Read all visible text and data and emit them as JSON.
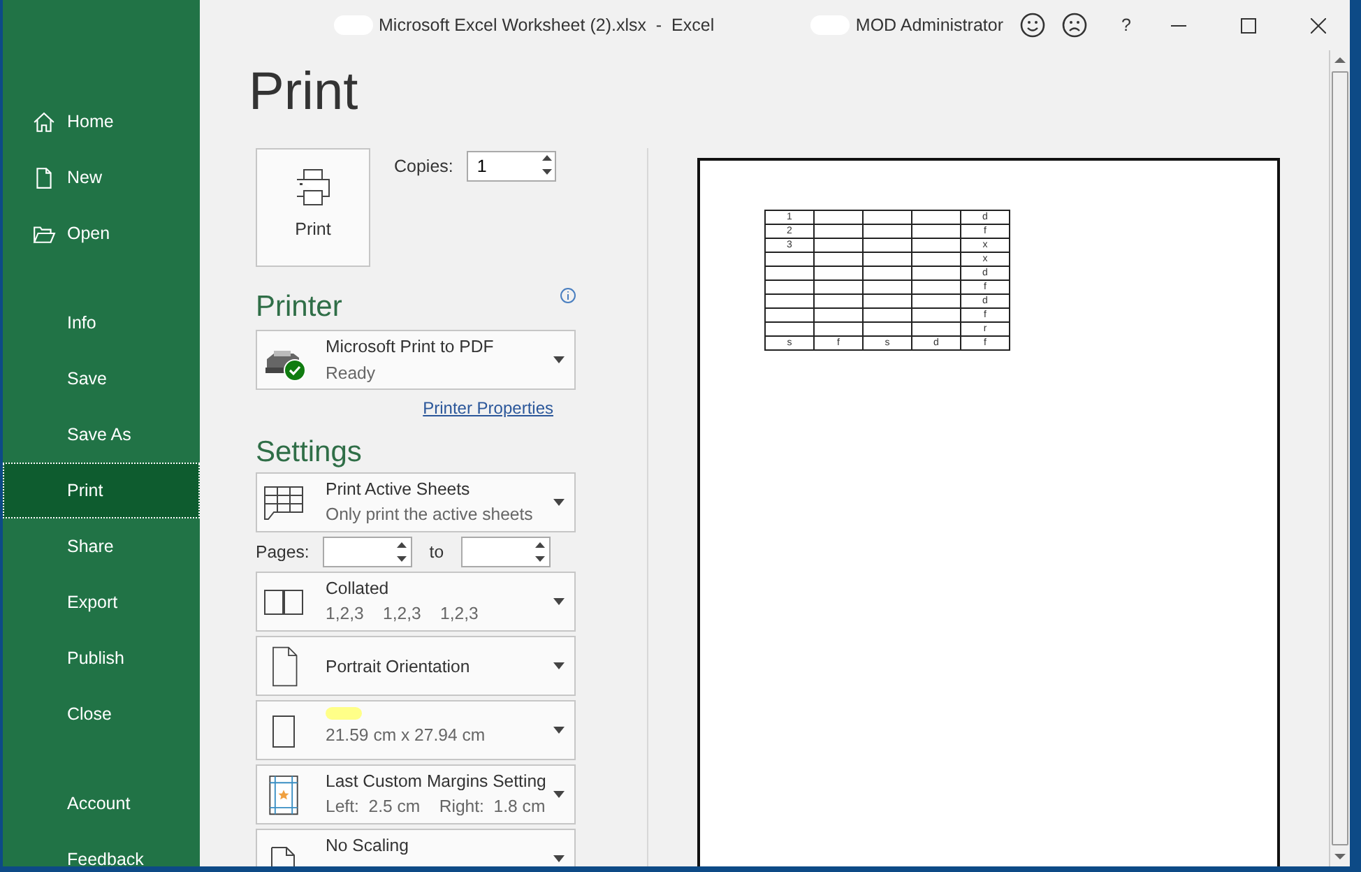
{
  "window": {
    "title": "Microsoft Excel Worksheet (2).xlsx  -  Excel",
    "title_redacted": true,
    "user": "MOD Administrator",
    "user_redacted": true,
    "help": "?"
  },
  "sidebar": {
    "groups": [
      [
        {
          "label": "Home",
          "selected": false
        },
        {
          "label": "New",
          "selected": false
        },
        {
          "label": "Open",
          "selected": false
        }
      ],
      [
        {
          "label": "Info",
          "selected": false
        },
        {
          "label": "Save",
          "selected": false
        },
        {
          "label": "Save As",
          "selected": false
        },
        {
          "label": "Print",
          "selected": true
        },
        {
          "label": "Share",
          "selected": false
        },
        {
          "label": "Export",
          "selected": false
        },
        {
          "label": "Publish",
          "selected": false
        },
        {
          "label": "Close",
          "selected": false
        }
      ],
      [
        {
          "label": "Account",
          "selected": false
        },
        {
          "label": "Feedback",
          "selected": false
        }
      ]
    ]
  },
  "print": {
    "heading": "Print",
    "button": "Print",
    "copies_label": "Copies:",
    "copies": "1"
  },
  "printer": {
    "heading": "Printer",
    "name": "Microsoft Print to PDF",
    "status": "Ready",
    "properties_link": "Printer Properties"
  },
  "settings": {
    "heading": "Settings",
    "items": [
      {
        "kind": "dropdown",
        "title": "Print Active Sheets",
        "subtitle": "Only print the active sheets"
      },
      {
        "kind": "pages",
        "label": "Pages:",
        "to": "to"
      },
      {
        "kind": "dropdown",
        "title": "Collated",
        "subtitle": "1,2,3    1,2,3    1,2,3"
      },
      {
        "kind": "dropdown",
        "title": "Portrait Orientation"
      },
      {
        "kind": "dropdown",
        "title_redacted": true,
        "subtitle": "21.59 cm x 27.94 cm"
      },
      {
        "kind": "dropdown",
        "title": "Last Custom Margins Setting",
        "subtitle": "Left:  2.5 cm    Right:  1.8 cm"
      },
      {
        "kind": "dropdown",
        "title": "No Scaling"
      }
    ]
  },
  "preview": {
    "rows": [
      [
        "1",
        null,
        null,
        null,
        "d"
      ],
      [
        "2",
        null,
        null,
        null,
        "f"
      ],
      [
        "3",
        null,
        null,
        null,
        "x"
      ],
      [
        null,
        null,
        null,
        null,
        "x"
      ],
      [
        null,
        null,
        null,
        null,
        "d"
      ],
      [
        null,
        null,
        null,
        null,
        "f"
      ],
      [
        null,
        null,
        null,
        null,
        "d"
      ],
      [
        null,
        null,
        null,
        null,
        "f"
      ],
      [
        null,
        null,
        null,
        null,
        "r"
      ],
      [
        "s",
        "f",
        "s",
        "d",
        "f"
      ]
    ]
  }
}
